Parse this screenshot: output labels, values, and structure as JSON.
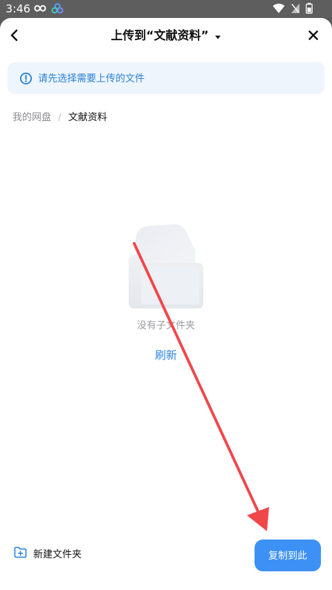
{
  "status_bar": {
    "time": "3:46",
    "icons": [
      "infinity-icon",
      "cloud-app-icon",
      "wifi-icon",
      "sim-off-icon",
      "battery-icon"
    ]
  },
  "header": {
    "title": "上传到“文献资料”",
    "back_icon": "chevron-left-icon",
    "close_icon": "close-icon",
    "dropdown_icon": "caret-down-icon"
  },
  "notice": {
    "text": "请先选择需要上传的文件",
    "icon": "info-circle-icon"
  },
  "breadcrumb": {
    "root": "我的网盘",
    "separator": "/",
    "current": "文献资料"
  },
  "empty_state": {
    "text": "没有子文件夹",
    "refresh_label": "刷新",
    "icon": "empty-folder-icon"
  },
  "footer": {
    "new_folder_label": "新建文件夹",
    "new_folder_icon": "folder-add-icon",
    "copy_label": "复制到此"
  },
  "colors": {
    "accent": "#3d91f5",
    "link": "#2f86e2",
    "notice_bg": "#eef5fd",
    "annotation_arrow": "#f0474b"
  }
}
